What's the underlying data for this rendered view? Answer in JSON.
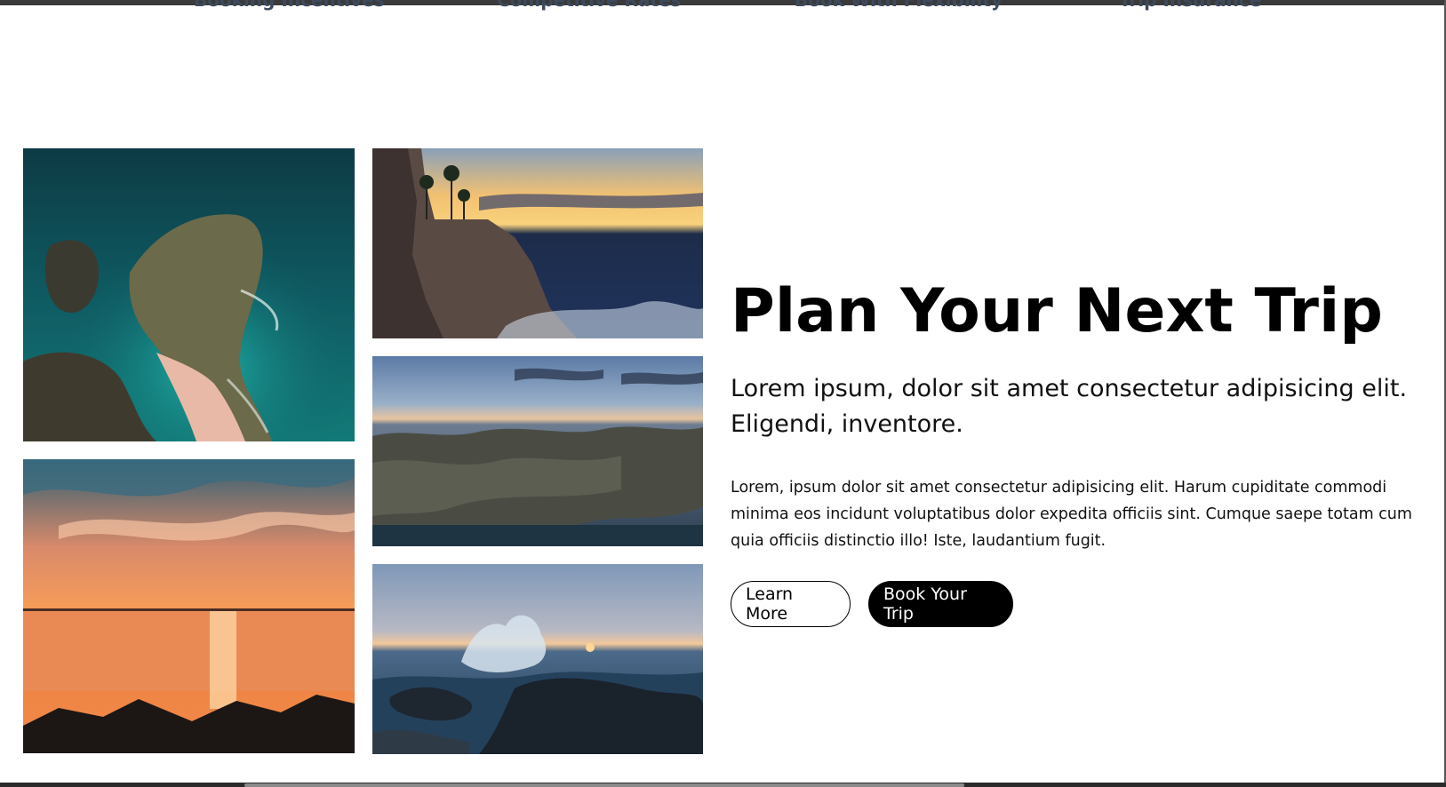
{
  "feature_nav": {
    "items": [
      "Booking Incentives",
      "Competitive Rates",
      "Book With Flexibility",
      "Trip Insurance"
    ]
  },
  "gallery": {
    "photos": [
      {
        "subject": "aerial view of a cliff and turquoise bay"
      },
      {
        "subject": "beach at sunset with orange sky and swimmers"
      },
      {
        "subject": "rocky cliff with palm trees at sunset over the sea"
      },
      {
        "subject": "rocky coastline at dusk"
      },
      {
        "subject": "waves crashing on rocks at sunset"
      }
    ]
  },
  "hero": {
    "title": "Plan Your Next Trip",
    "subtitle": "Lorem ipsum, dolor sit amet consectetur adipisicing elit. Eligendi, inventore.",
    "body": "Lorem, ipsum dolor sit amet consectetur adipisicing elit. Harum cupiditate commodi minima eos incidunt voluptatibus dolor expedita officiis sint. Cumque saepe totam cum quia officiis distinctio illo! Iste, laudantium fugit.",
    "learn_more_label": "Learn More",
    "book_label": "Book Your Trip"
  }
}
